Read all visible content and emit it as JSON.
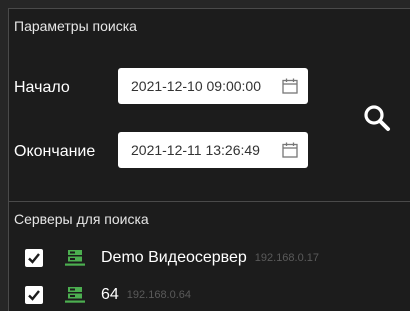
{
  "search_params": {
    "title": "Параметры поиска",
    "start_label": "Начало",
    "start_value": "2021-12-10 09:00:00",
    "end_label": "Окончание",
    "end_value": "2021-12-11 13:26:49"
  },
  "servers": {
    "title": "Серверы для поиска",
    "items": [
      {
        "name": "Demo Видеосервер",
        "ip": "192.168.0.17",
        "checked": true
      },
      {
        "name": "64",
        "ip": "192.168.0.64",
        "checked": true
      }
    ]
  },
  "colors": {
    "background": "#1c1c1c",
    "server_icon": "#4caf50",
    "ip_text": "#5a5a5a"
  },
  "icons": {
    "search": "search-icon",
    "calendar": "calendar-icon",
    "server": "server-icon",
    "checkmark": "checkmark-icon"
  }
}
